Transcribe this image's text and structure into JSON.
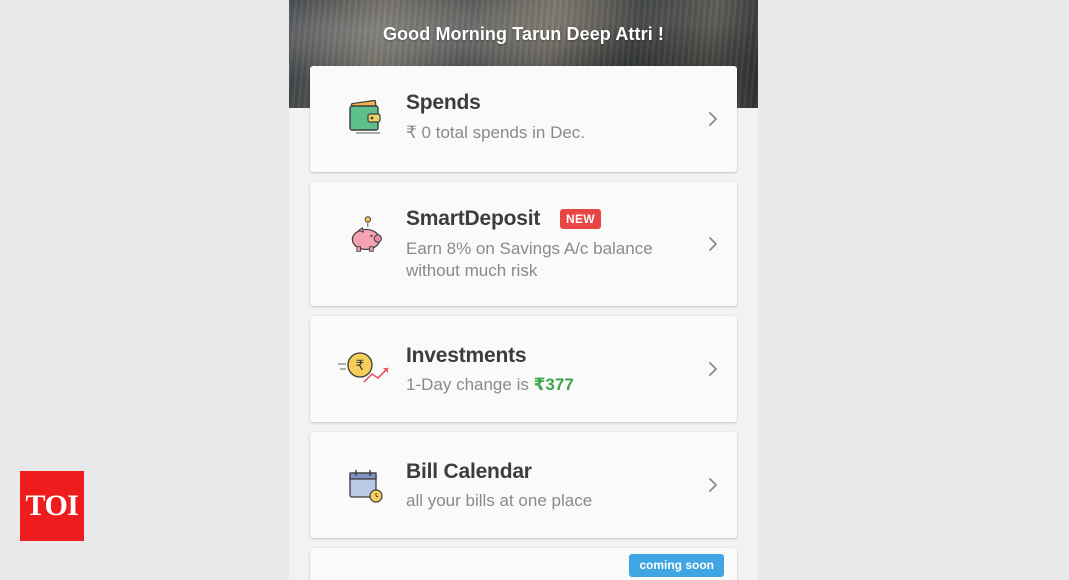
{
  "header": {
    "greeting": "Good Morning Tarun Deep Attri !"
  },
  "cards": {
    "spends": {
      "title": "Spends",
      "subtitle": "₹ 0 total spends in Dec.",
      "icon": "wallet-icon"
    },
    "smart_deposit": {
      "title": "SmartDeposit",
      "badge": "NEW",
      "subtitle": "Earn 8% on Savings A/c balance without much risk",
      "icon": "piggy-bank-icon"
    },
    "investments": {
      "title": "Investments",
      "subtitle_prefix": "1-Day change is ",
      "change_value": "₹377",
      "icon": "rupee-coin-growth-icon"
    },
    "bill_calendar": {
      "title": "Bill Calendar",
      "subtitle": "all your bills at one place",
      "icon": "calendar-clock-icon"
    },
    "next_card": {
      "badge": "coming soon"
    }
  },
  "watermark": {
    "logo_text": "TOI"
  },
  "colors": {
    "accent_green": "#3aa64a",
    "badge_new": "#e84545",
    "badge_soon": "#3fa5e3",
    "watermark_red": "#ee1c1c"
  }
}
